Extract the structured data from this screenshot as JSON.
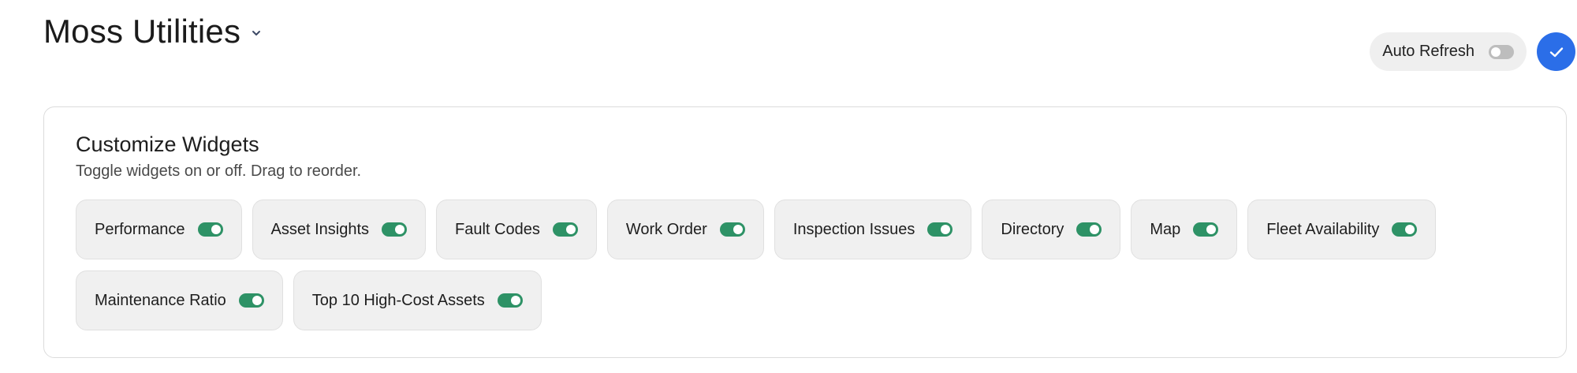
{
  "header": {
    "title": "Moss Utilities",
    "title_dropdown_icon": "chevron-down-icon",
    "auto_refresh": {
      "label": "Auto Refresh",
      "enabled": false
    },
    "confirm_icon": "check-icon",
    "accent_color": "#2b6ee8"
  },
  "panel": {
    "title": "Customize Widgets",
    "subtitle": "Toggle widgets on or off. Drag to reorder.",
    "toggle_on_color": "#2e9266",
    "widgets": [
      {
        "label": "Performance",
        "enabled": true
      },
      {
        "label": "Asset Insights",
        "enabled": true
      },
      {
        "label": "Fault Codes",
        "enabled": true
      },
      {
        "label": "Work Order",
        "enabled": true
      },
      {
        "label": "Inspection Issues",
        "enabled": true
      },
      {
        "label": "Directory",
        "enabled": true
      },
      {
        "label": "Map",
        "enabled": true
      },
      {
        "label": "Fleet Availability",
        "enabled": true
      },
      {
        "label": "Maintenance Ratio",
        "enabled": true
      },
      {
        "label": "Top 10 High-Cost Assets",
        "enabled": true
      }
    ]
  }
}
